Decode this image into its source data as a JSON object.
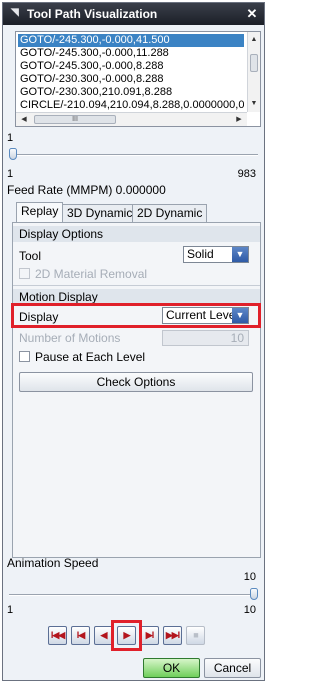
{
  "window": {
    "title": "Tool Path Visualization",
    "close_glyph": "✕"
  },
  "path_list": {
    "rows": [
      "GOTO/-245.300,-0.000,41.500",
      "GOTO/-245.300,-0.000,11.288",
      "GOTO/-245.300,-0.000,8.288",
      "GOTO/-230.300,-0.000,8.288",
      "GOTO/-230.300,210.091,8.288",
      "CIRCLE/-210.094,210.094,8.288,0.0000000,0"
    ],
    "selected_index": 0,
    "hscroll_thumb_glyph": "III"
  },
  "motion_slider": {
    "value": "1",
    "min": "1",
    "max": "983",
    "fraction": 0.0
  },
  "feed_rate": "Feed Rate (MMPM) 0.000000",
  "tabs": [
    {
      "label": "Replay",
      "active": true
    },
    {
      "label": "3D Dynamic",
      "active": false
    },
    {
      "label": "2D Dynamic",
      "active": false
    }
  ],
  "display_options": {
    "header": "Display Options",
    "tool_label": "Tool",
    "tool_value": "Solid",
    "material_removal_label": "2D Material Removal"
  },
  "motion_display": {
    "header": "Motion Display",
    "display_label": "Display",
    "display_value": "Current Level",
    "number_of_motions_label": "Number of Motions",
    "number_of_motions_value": "10",
    "pause_label": "Pause at Each Level",
    "check_options_label": "Check Options"
  },
  "animation": {
    "label": "Animation Speed",
    "value": "10",
    "min": "1",
    "max": "10",
    "fraction": 1.0
  },
  "playback": {
    "first_glyph": "I◀◀",
    "step_back_glyph": "I◀",
    "back_glyph": "◀",
    "play_glyph": "▶",
    "step_forward_glyph": "▶I",
    "last_glyph": "▶▶I",
    "stop_glyph": "■"
  },
  "footer": {
    "ok_label": "OK",
    "cancel_label": "Cancel"
  },
  "icons": {
    "window_icon": "wand-icon",
    "dropdown": "dropdown-arrow-icon"
  },
  "colors": {
    "highlight": "#e0202a",
    "selection": "#3b83c4",
    "accent_red": "#b3141c"
  }
}
